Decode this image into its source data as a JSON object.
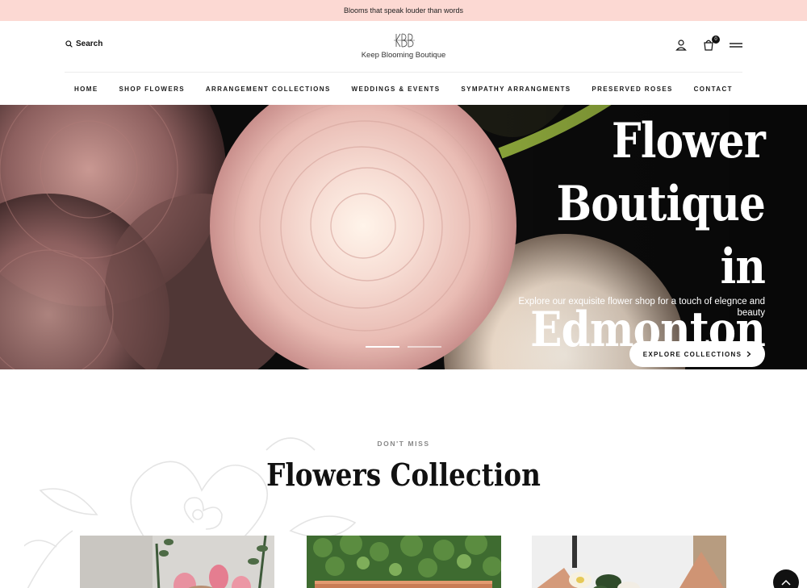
{
  "announcement": "Blooms that speak louder than words",
  "header": {
    "search_label": "Search",
    "logo_mark": "KBB",
    "brand_name": "Keep Blooming Boutique",
    "cart_count": "0"
  },
  "nav": [
    "HOME",
    "SHOP FLOWERS",
    "ARRANGEMENT COLLECTIONS",
    "WEDDINGS & EVENTS",
    "SYMPATHY ARRANGMENTS",
    "PRESERVED ROSES",
    "CONTACT"
  ],
  "hero": {
    "title": "Flower Boutique in Edmonton",
    "subtitle": "Explore our exquisite flower shop for a touch of elegnce and beauty",
    "button_label": "EXPLORE COLLECTIONS",
    "slides": 2,
    "active_slide": 1
  },
  "collection": {
    "eyebrow": "DON'T MISS",
    "title": "Flowers Collection"
  },
  "colors": {
    "announcement_bg": "#fcd9d3",
    "hero_dark": "#0a0a0a",
    "petal": "#f3d3cc"
  },
  "icons": [
    "search-icon",
    "user-icon",
    "cart-icon",
    "menu-icon",
    "chevron-right-icon",
    "chevron-up-icon"
  ]
}
